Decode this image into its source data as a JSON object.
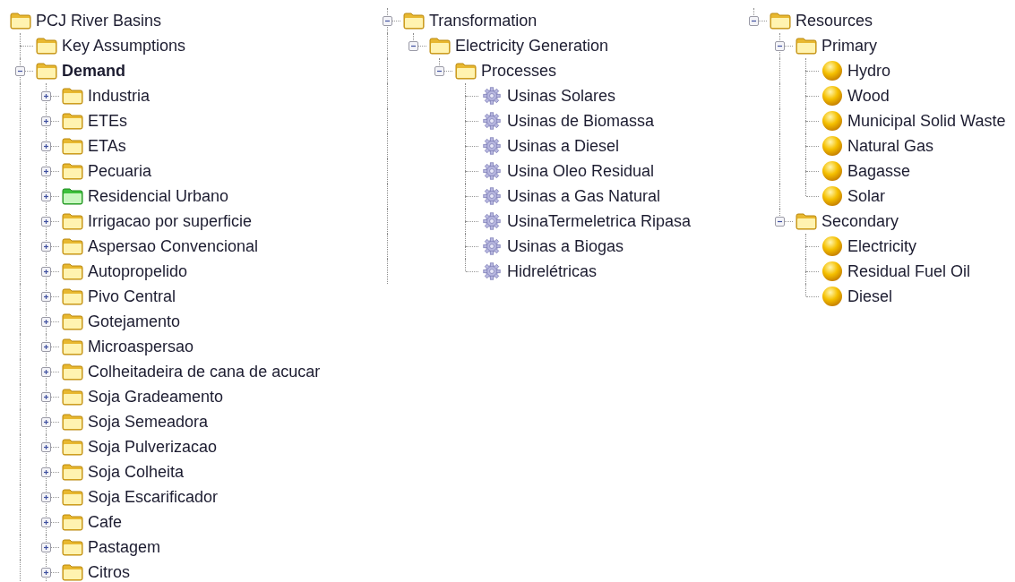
{
  "panels": [
    {
      "items": [
        {
          "label": "PCJ River Basins",
          "kind": "folder",
          "more_below": true,
          "children": [
            {
              "label": "Key Assumptions",
              "kind": "folder"
            },
            {
              "label": "Demand",
              "kind": "folder",
              "bold": true,
              "expanded": true,
              "more_below": true,
              "children": [
                {
                  "label": "Industria",
                  "kind": "folder",
                  "expanded": false
                },
                {
                  "label": "ETEs",
                  "kind": "folder",
                  "expanded": false
                },
                {
                  "label": "ETAs",
                  "kind": "folder",
                  "expanded": false
                },
                {
                  "label": "Pecuaria",
                  "kind": "folder",
                  "expanded": false
                },
                {
                  "label": "Residencial Urbano",
                  "kind": "green-folder",
                  "expanded": false
                },
                {
                  "label": "Irrigacao por superficie",
                  "kind": "folder",
                  "expanded": false
                },
                {
                  "label": "Aspersao Convencional",
                  "kind": "folder",
                  "expanded": false
                },
                {
                  "label": "Autopropelido",
                  "kind": "folder",
                  "expanded": false
                },
                {
                  "label": "Pivo Central",
                  "kind": "folder",
                  "expanded": false
                },
                {
                  "label": "Gotejamento",
                  "kind": "folder",
                  "expanded": false
                },
                {
                  "label": "Microaspersao",
                  "kind": "folder",
                  "expanded": false
                },
                {
                  "label": "Colheitadeira de cana de acucar",
                  "kind": "folder",
                  "expanded": false
                },
                {
                  "label": "Soja Gradeamento",
                  "kind": "folder",
                  "expanded": false
                },
                {
                  "label": "Soja Semeadora",
                  "kind": "folder",
                  "expanded": false
                },
                {
                  "label": "Soja Pulverizacao",
                  "kind": "folder",
                  "expanded": false
                },
                {
                  "label": "Soja Colheita",
                  "kind": "folder",
                  "expanded": false
                },
                {
                  "label": "Soja Escarificador",
                  "kind": "folder",
                  "expanded": false
                },
                {
                  "label": "Cafe",
                  "kind": "folder",
                  "expanded": false
                },
                {
                  "label": "Pastagem",
                  "kind": "folder",
                  "expanded": false
                },
                {
                  "label": "Citros",
                  "kind": "folder",
                  "expanded": false
                }
              ]
            }
          ]
        }
      ]
    },
    {
      "trunk": {
        "above": true,
        "below": true
      },
      "items": [
        {
          "label": "Transformation",
          "kind": "folder",
          "expanded": true,
          "children": [
            {
              "label": "Electricity Generation",
              "kind": "folder",
              "expanded": true,
              "children": [
                {
                  "label": "Processes",
                  "kind": "folder",
                  "expanded": true,
                  "children": [
                    {
                      "label": "Usinas Solares",
                      "kind": "process"
                    },
                    {
                      "label": "Usinas de Biomassa",
                      "kind": "process"
                    },
                    {
                      "label": "Usinas a Diesel",
                      "kind": "process"
                    },
                    {
                      "label": "Usina Oleo Residual",
                      "kind": "process"
                    },
                    {
                      "label": "Usinas a Gas Natural",
                      "kind": "process"
                    },
                    {
                      "label": "UsinaTermeletrica Ripasa",
                      "kind": "process"
                    },
                    {
                      "label": "Usinas a Biogas",
                      "kind": "process"
                    },
                    {
                      "label": "Hidrelétricas",
                      "kind": "process"
                    }
                  ]
                }
              ]
            }
          ]
        }
      ]
    },
    {
      "trunk": {
        "above": true,
        "below": false
      },
      "items": [
        {
          "label": "Resources",
          "kind": "folder",
          "expanded": true,
          "children": [
            {
              "label": "Primary",
              "kind": "folder",
              "expanded": true,
              "children": [
                {
                  "label": "Hydro",
                  "kind": "resource"
                },
                {
                  "label": "Wood",
                  "kind": "resource"
                },
                {
                  "label": "Municipal Solid Waste",
                  "kind": "resource"
                },
                {
                  "label": "Natural Gas",
                  "kind": "resource"
                },
                {
                  "label": "Bagasse",
                  "kind": "resource"
                },
                {
                  "label": "Solar",
                  "kind": "resource"
                }
              ]
            },
            {
              "label": "Secondary",
              "kind": "folder",
              "expanded": true,
              "children": [
                {
                  "label": "Electricity",
                  "kind": "resource"
                },
                {
                  "label": "Residual Fuel Oil",
                  "kind": "resource"
                },
                {
                  "label": "Diesel",
                  "kind": "resource"
                }
              ]
            }
          ]
        }
      ]
    }
  ]
}
